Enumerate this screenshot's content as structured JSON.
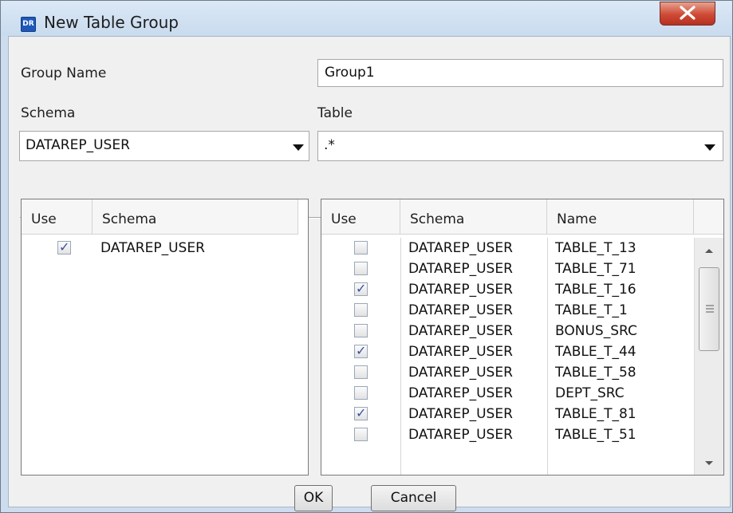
{
  "window": {
    "title": "New Table Group",
    "app_icon_text": "DR",
    "close_icon": "close-icon"
  },
  "form": {
    "group_name_label": "Group Name",
    "group_name_value": "Group1",
    "schema_label": "Schema",
    "table_label": "Table",
    "schema_combo_value": "DATAREP_USER",
    "table_combo_value": ".*"
  },
  "schema_table": {
    "headers": [
      "Use",
      "Schema"
    ],
    "rows": [
      {
        "use": true,
        "schema": "DATAREP_USER"
      }
    ]
  },
  "tables_table": {
    "headers": [
      "Use",
      "Schema",
      "Name"
    ],
    "rows": [
      {
        "use": false,
        "schema": "DATAREP_USER",
        "name": "TABLE_T_13"
      },
      {
        "use": false,
        "schema": "DATAREP_USER",
        "name": "TABLE_T_71"
      },
      {
        "use": true,
        "schema": "DATAREP_USER",
        "name": "TABLE_T_16"
      },
      {
        "use": false,
        "schema": "DATAREP_USER",
        "name": "TABLE_T_1"
      },
      {
        "use": false,
        "schema": "DATAREP_USER",
        "name": "BONUS_SRC"
      },
      {
        "use": true,
        "schema": "DATAREP_USER",
        "name": "TABLE_T_44"
      },
      {
        "use": false,
        "schema": "DATAREP_USER",
        "name": "TABLE_T_58"
      },
      {
        "use": false,
        "schema": "DATAREP_USER",
        "name": "DEPT_SRC"
      },
      {
        "use": true,
        "schema": "DATAREP_USER",
        "name": "TABLE_T_81"
      },
      {
        "use": false,
        "schema": "DATAREP_USER",
        "name": "TABLE_T_51"
      }
    ]
  },
  "buttons": {
    "ok_label": "OK",
    "cancel_label": "Cancel"
  },
  "colors": {
    "title_bar": "#cddcee",
    "close_button": "#c9412e",
    "check_mark": "#3b4f9e"
  }
}
